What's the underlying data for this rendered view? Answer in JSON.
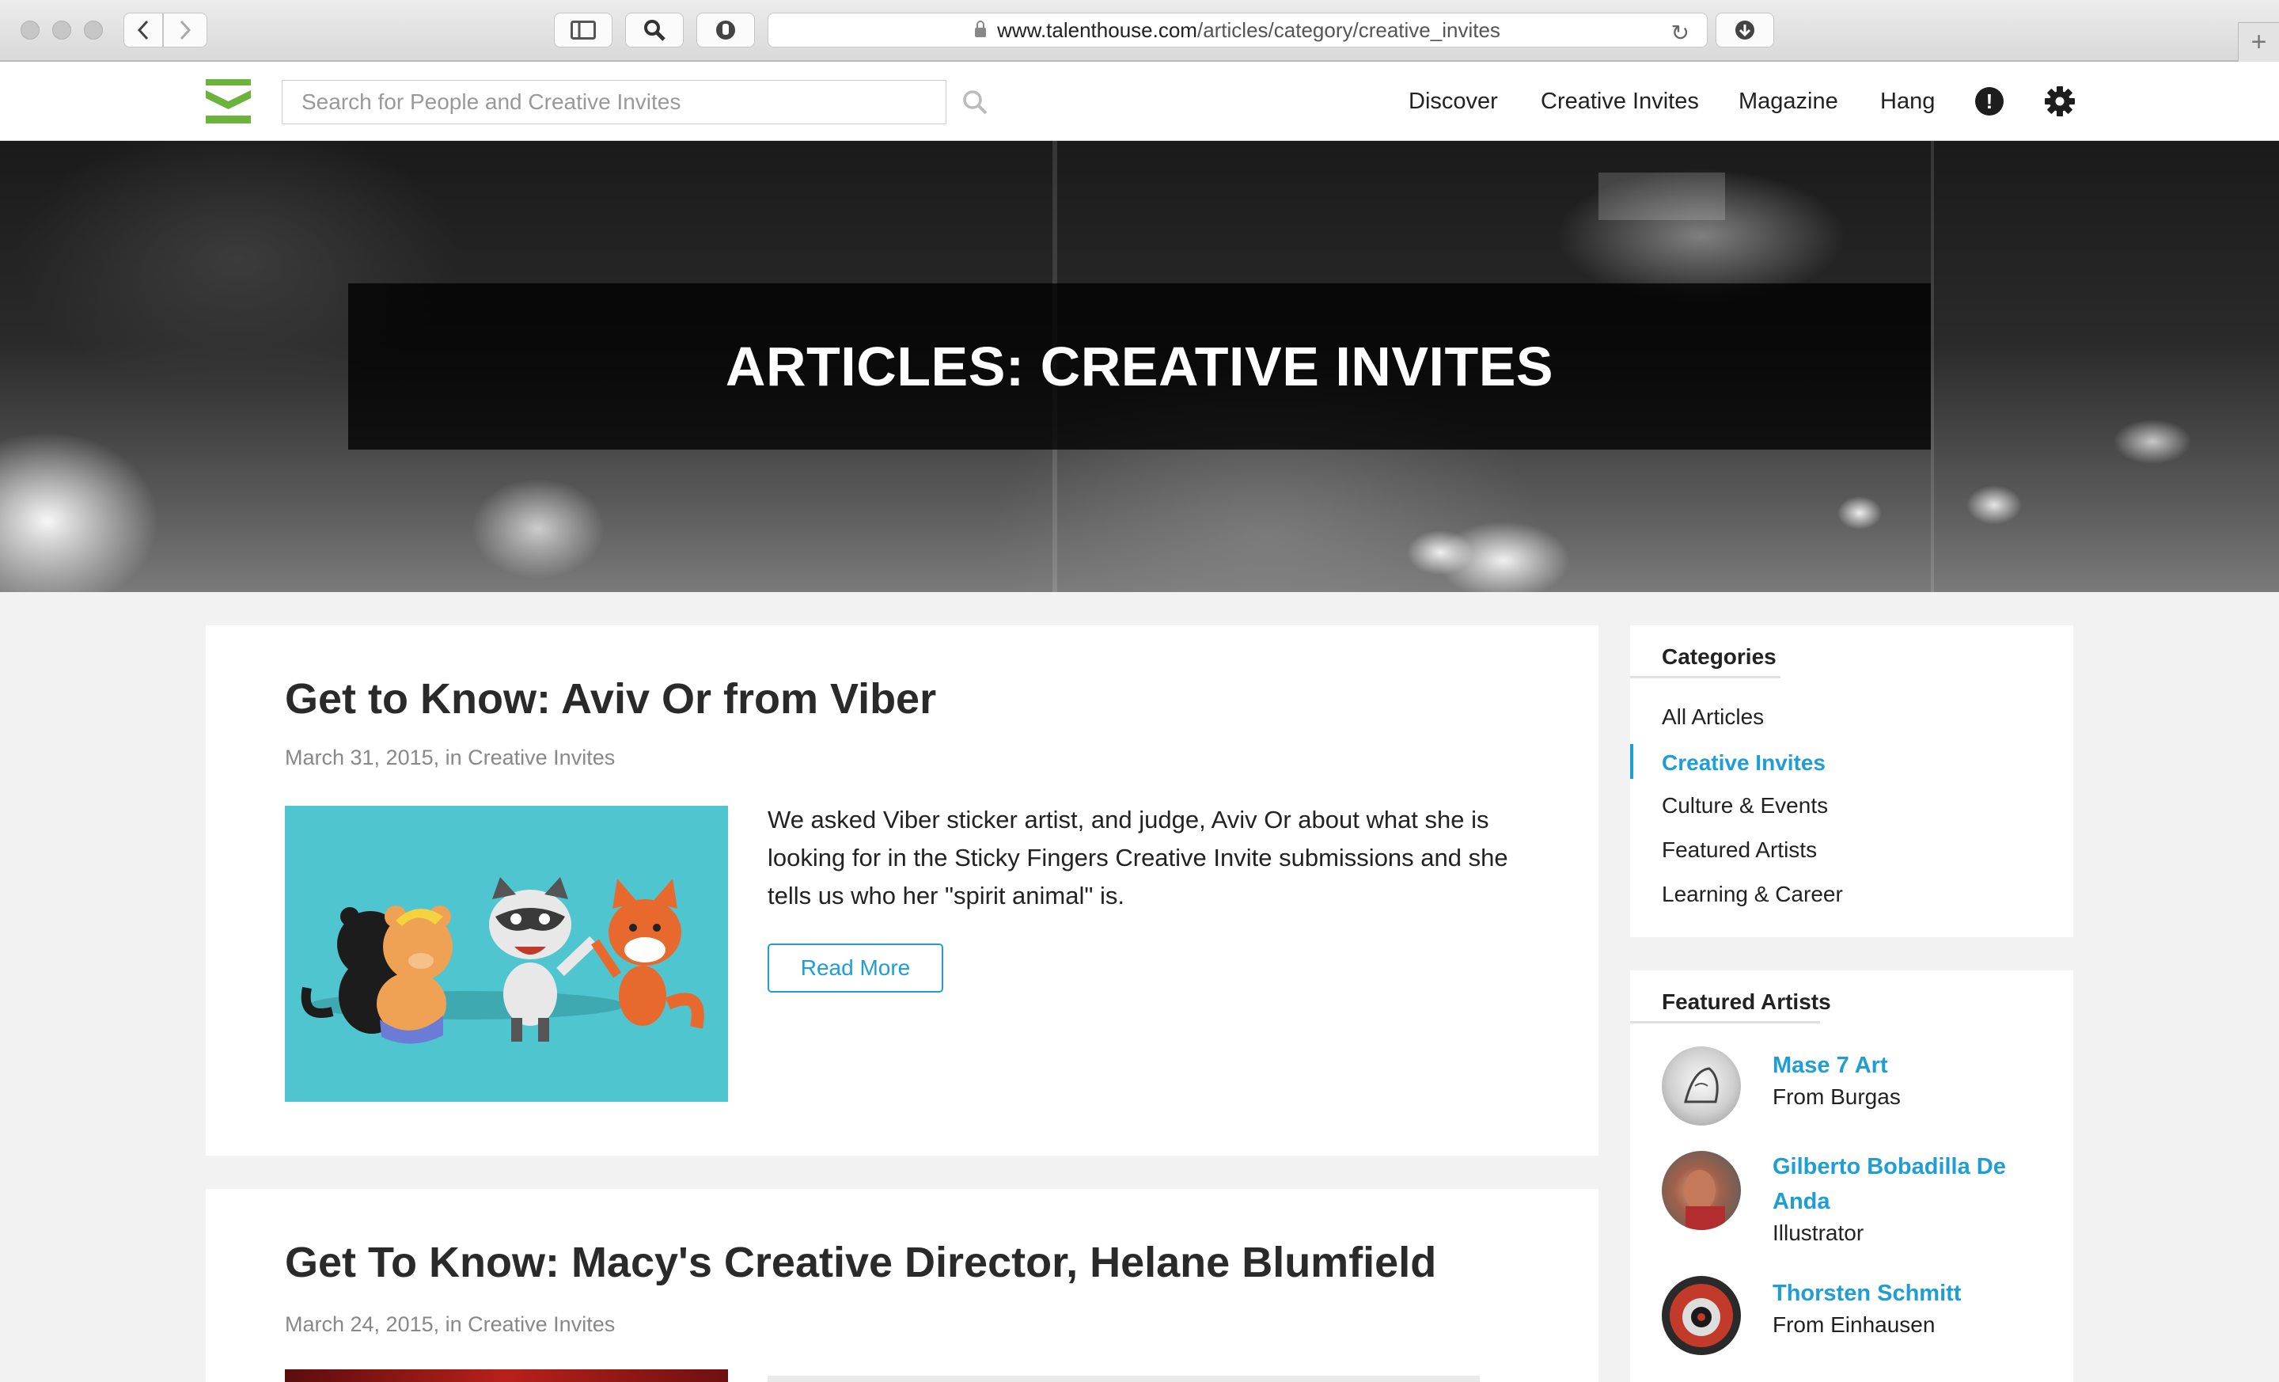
{
  "browser": {
    "url_domain": "www.talenthouse.com",
    "url_path": "/articles/category/creative_invites",
    "new_tab_label": "+"
  },
  "header": {
    "search_placeholder": "Search for People and Creative Invites",
    "nav": [
      "Discover",
      "Creative Invites",
      "Magazine",
      "Hang"
    ],
    "alert_label": "!",
    "brand_color": "#6cb33e"
  },
  "hero": {
    "title": "ARTICLES: CREATIVE INVITES"
  },
  "articles": [
    {
      "title": "Get to Know: Aviv Or from Viber",
      "meta": "March 31, 2015, in Creative Invites",
      "excerpt": "We asked Viber sticker artist, and judge, Aviv Or about what she is looking for in the Sticky Fingers Creative Invite submissions and she tells us who her \"spirit animal\" is.",
      "button": "Read More"
    },
    {
      "title": "Get To Know: Macy's Creative Director, Helane Blumfield",
      "meta": "March 24, 2015, in Creative Invites"
    }
  ],
  "sidebar": {
    "categories_heading": "Categories",
    "categories": [
      "All Articles",
      "Creative Invites",
      "Culture & Events",
      "Featured Artists",
      "Learning & Career"
    ],
    "active_category": "Creative Invites",
    "featured_heading": "Featured Artists",
    "artists": [
      {
        "name": "Mase 7 Art",
        "subtitle": "From Burgas"
      },
      {
        "name": "Gilberto Bobadilla De Anda",
        "subtitle": "Illustrator"
      },
      {
        "name": "Thorsten Schmitt",
        "subtitle": "From Einhausen"
      }
    ]
  },
  "colors": {
    "accent": "#1e9ed4",
    "thumb_background": "#4ec5cf"
  }
}
